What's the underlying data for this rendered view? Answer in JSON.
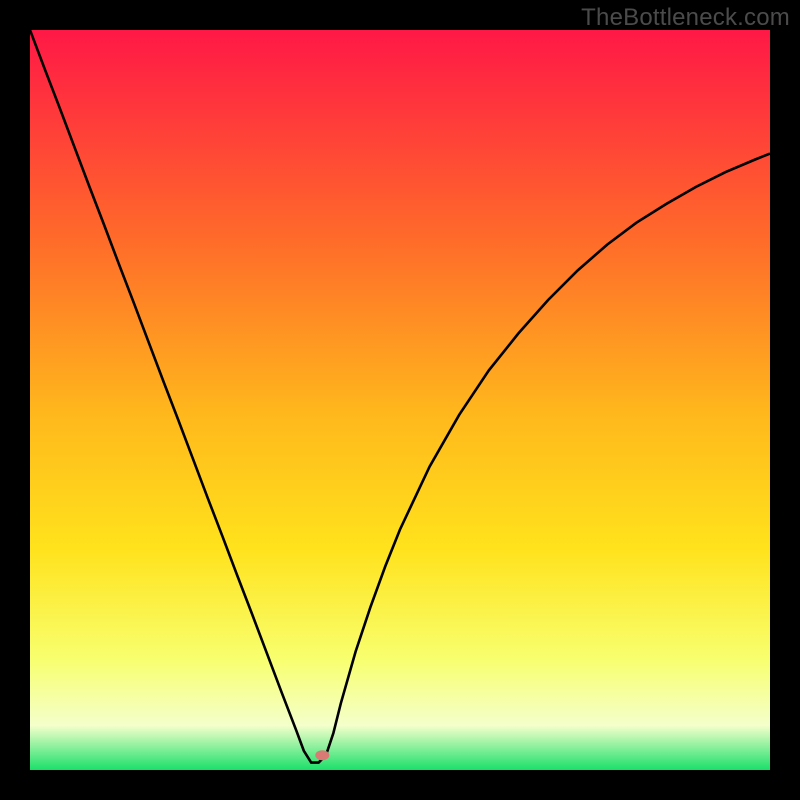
{
  "watermark": "TheBottleneck.com",
  "colors": {
    "bg": "#000000",
    "curve": "#000000",
    "watermark": "#4b4b4b",
    "gradient_top": "#ff1846",
    "gradient_mid1": "#ff6a2a",
    "gradient_mid2": "#ffb81c",
    "gradient_mid3": "#ffe21c",
    "gradient_mid4": "#f8ff6e",
    "gradient_band": "#f4ffcb",
    "gradient_bottom": "#1be06a",
    "marker": "#d97b74"
  },
  "chart_data": {
    "type": "line",
    "title": "",
    "xlabel": "",
    "ylabel": "",
    "xlim": [
      0,
      100
    ],
    "ylim": [
      0,
      100
    ],
    "notch_x": 38,
    "marker": {
      "x": 39.5,
      "y": 2
    },
    "series": [
      {
        "name": "curve",
        "x": [
          0,
          2,
          4,
          6,
          8,
          10,
          12,
          14,
          16,
          18,
          20,
          22,
          24,
          26,
          28,
          30,
          32,
          34,
          35,
          36,
          37,
          38,
          39,
          40,
          41,
          42,
          44,
          46,
          48,
          50,
          54,
          58,
          62,
          66,
          70,
          74,
          78,
          82,
          86,
          90,
          94,
          98,
          100
        ],
        "y": [
          100,
          94.7,
          89.5,
          84.2,
          78.9,
          73.7,
          68.4,
          63.2,
          57.9,
          52.6,
          47.4,
          42.1,
          36.8,
          31.6,
          26.3,
          21.1,
          15.8,
          10.5,
          7.9,
          5.3,
          2.6,
          1.0,
          1.0,
          2.0,
          5.0,
          9.0,
          16.0,
          22.0,
          27.5,
          32.5,
          41.0,
          48.0,
          54.0,
          59.0,
          63.5,
          67.5,
          71.0,
          74.0,
          76.5,
          78.8,
          80.8,
          82.5,
          83.3
        ]
      }
    ]
  }
}
